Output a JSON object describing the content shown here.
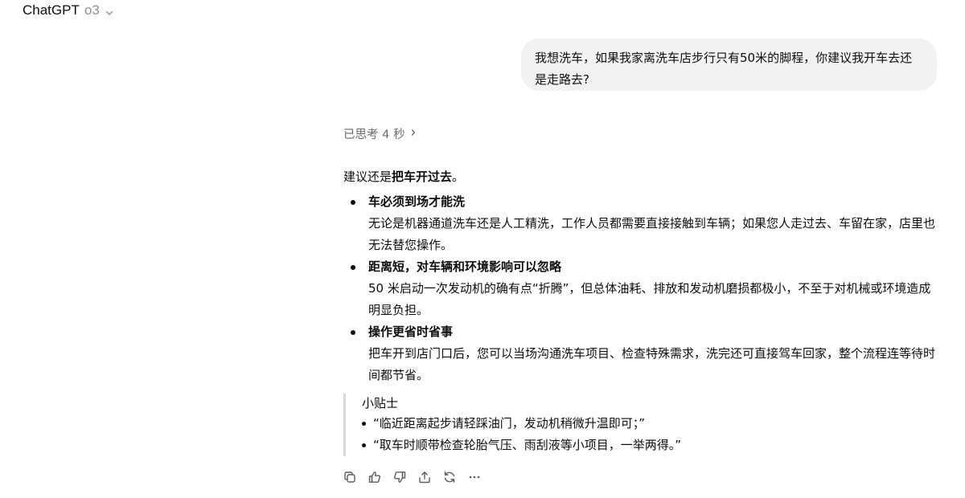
{
  "header": {
    "model_name": "ChatGPT",
    "model_version": "o3",
    "chevron_icon": "chevron-down-icon"
  },
  "user_message": {
    "text": "我想洗车，如果我家离洗车店步行只有50米的脚程，你建议我开车去还是走路去?"
  },
  "thinking": {
    "label": "已思考 4 秒",
    "icon": "chevron-right-icon"
  },
  "answer": {
    "intro_prefix": "建议还是",
    "intro_bold": "把车开过去",
    "intro_suffix": "。",
    "points": [
      {
        "title": "车必须到场才能洗",
        "body": "无论是机器通道洗车还是人工精洗，工作人员都需要直接接触到车辆；如果您人走过去、车留在家，店里也无法替您操作。"
      },
      {
        "title": "距离短，对车辆和环境影响可以忽略",
        "body": "50 米启动一次发动机的确有点“折腾”，但总体油耗、排放和发动机磨损都极小，不至于对机械或环境造成明显负担。"
      },
      {
        "title": "操作更省时省事",
        "body": "把车开到店门口后，您可以当场沟通洗车项目、检查特殊需求，洗完还可直接驾车回家，整个流程连等待时间都节省。"
      }
    ],
    "tips": {
      "title": "小贴士",
      "items": [
        "“临近距离起步请轻踩油门，发动机稍微升温即可；”",
        "“取车时顺带检查轮胎气压、雨刮液等小项目，一举两得。”"
      ]
    }
  },
  "actions": {
    "icons": [
      "copy-icon",
      "thumbs-up-icon",
      "thumbs-down-icon",
      "share-icon",
      "regenerate-icon",
      "more-icon"
    ]
  }
}
